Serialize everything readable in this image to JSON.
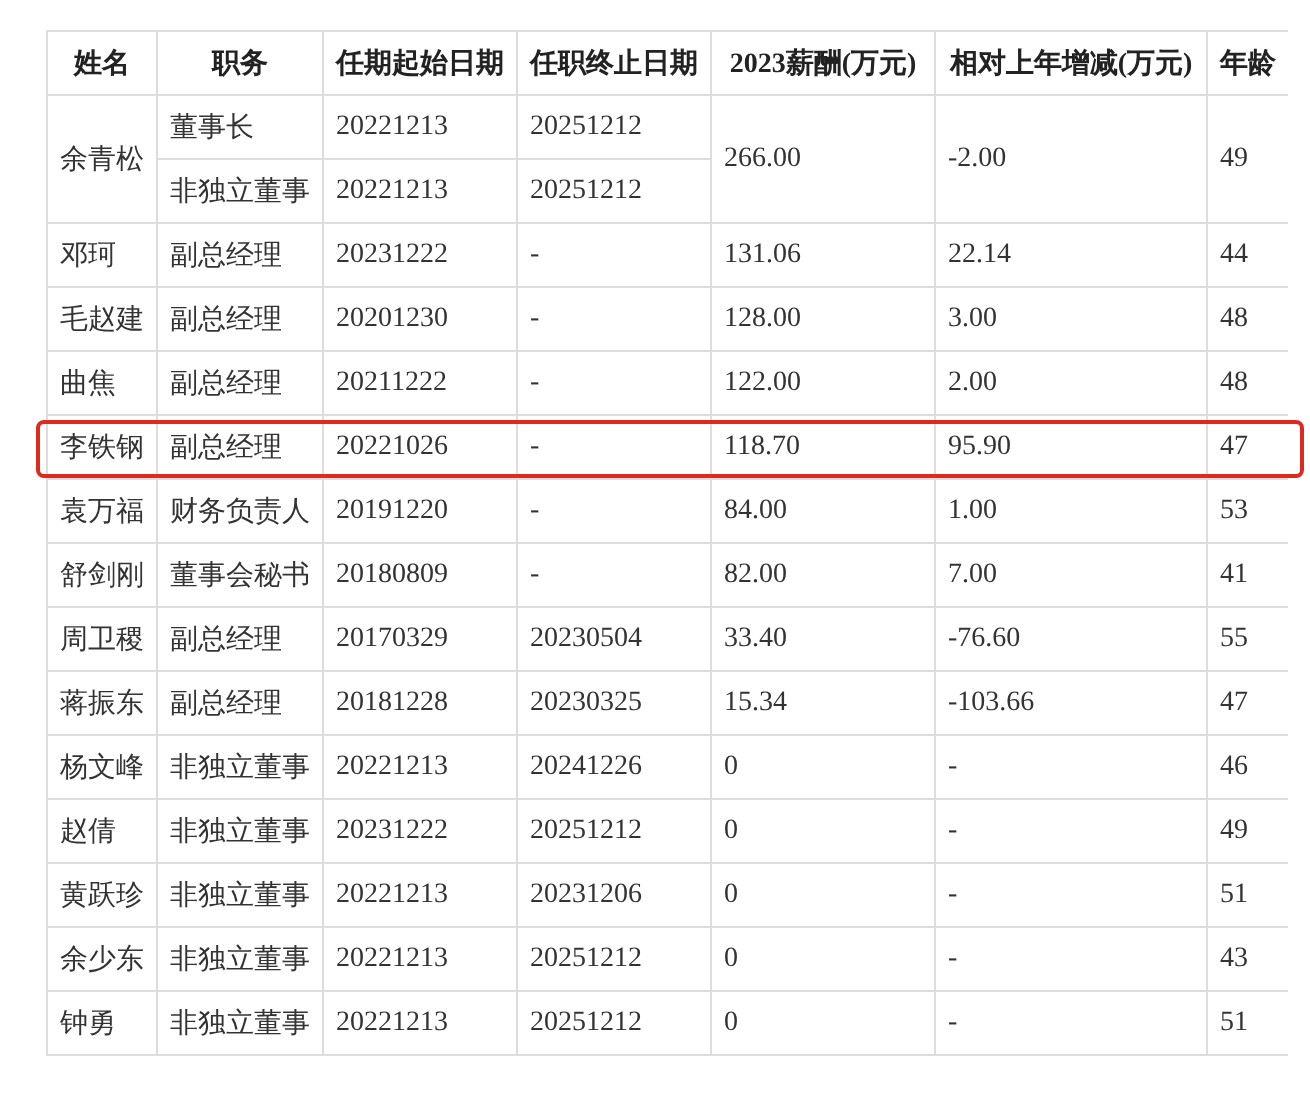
{
  "table": {
    "columns": [
      "姓名",
      "职务",
      "任期起始日期",
      "任职终止日期",
      "2023薪酬(万元)",
      "相对上年增减(万元)",
      "年龄"
    ],
    "rows": [
      {
        "name": "余青松",
        "positions": [
          {
            "title": "董事长",
            "start": "20221213",
            "end": "20251212"
          },
          {
            "title": "非独立董事",
            "start": "20221213",
            "end": "20251212"
          }
        ],
        "pay": "266.00",
        "change": "-2.00",
        "age": "49",
        "highlighted": false
      },
      {
        "name": "邓珂",
        "positions": [
          {
            "title": "副总经理",
            "start": "20231222",
            "end": "-"
          }
        ],
        "pay": "131.06",
        "change": "22.14",
        "age": "44",
        "highlighted": false
      },
      {
        "name": "毛赵建",
        "positions": [
          {
            "title": "副总经理",
            "start": "20201230",
            "end": "-"
          }
        ],
        "pay": "128.00",
        "change": "3.00",
        "age": "48",
        "highlighted": false
      },
      {
        "name": "曲焦",
        "positions": [
          {
            "title": "副总经理",
            "start": "20211222",
            "end": "-"
          }
        ],
        "pay": "122.00",
        "change": "2.00",
        "age": "48",
        "highlighted": false
      },
      {
        "name": "李铁钢",
        "positions": [
          {
            "title": "副总经理",
            "start": "20221026",
            "end": "-"
          }
        ],
        "pay": "118.70",
        "change": "95.90",
        "age": "47",
        "highlighted": true
      },
      {
        "name": "袁万福",
        "positions": [
          {
            "title": "财务负责人",
            "start": "20191220",
            "end": "-"
          }
        ],
        "pay": "84.00",
        "change": "1.00",
        "age": "53",
        "highlighted": false
      },
      {
        "name": "舒剑刚",
        "positions": [
          {
            "title": "董事会秘书",
            "start": "20180809",
            "end": "-"
          }
        ],
        "pay": "82.00",
        "change": "7.00",
        "age": "41",
        "highlighted": false
      },
      {
        "name": "周卫稷",
        "positions": [
          {
            "title": "副总经理",
            "start": "20170329",
            "end": "20230504"
          }
        ],
        "pay": "33.40",
        "change": "-76.60",
        "age": "55",
        "highlighted": false
      },
      {
        "name": "蒋振东",
        "positions": [
          {
            "title": "副总经理",
            "start": "20181228",
            "end": "20230325"
          }
        ],
        "pay": "15.34",
        "change": "-103.66",
        "age": "47",
        "highlighted": false
      },
      {
        "name": "杨文峰",
        "positions": [
          {
            "title": "非独立董事",
            "start": "20221213",
            "end": "20241226"
          }
        ],
        "pay": "0",
        "change": "-",
        "age": "46",
        "highlighted": false
      },
      {
        "name": "赵倩",
        "positions": [
          {
            "title": "非独立董事",
            "start": "20231222",
            "end": "20251212"
          }
        ],
        "pay": "0",
        "change": "-",
        "age": "49",
        "highlighted": false
      },
      {
        "name": "黄跃珍",
        "positions": [
          {
            "title": "非独立董事",
            "start": "20221213",
            "end": "20231206"
          }
        ],
        "pay": "0",
        "change": "-",
        "age": "51",
        "highlighted": false
      },
      {
        "name": "余少东",
        "positions": [
          {
            "title": "非独立董事",
            "start": "20221213",
            "end": "20251212"
          }
        ],
        "pay": "0",
        "change": "-",
        "age": "43",
        "highlighted": false
      },
      {
        "name": "钟勇",
        "positions": [
          {
            "title": "非独立董事",
            "start": "20221213",
            "end": "20251212"
          }
        ],
        "pay": "0",
        "change": "-",
        "age": "51",
        "highlighted": false
      }
    ]
  }
}
